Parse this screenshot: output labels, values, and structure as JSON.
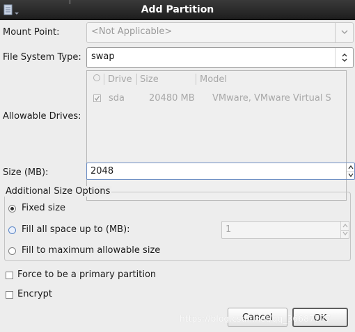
{
  "window": {
    "title": "Add Partition"
  },
  "mount_point": {
    "label": "Mount Point:",
    "value": "<Not Applicable>"
  },
  "fs_type": {
    "label": "File System Type:",
    "value": "swap"
  },
  "drives": {
    "label": "Allowable Drives:",
    "columns": [
      "Drive",
      "Size",
      "Model"
    ],
    "rows": [
      {
        "drive": "sda",
        "size": "20480 MB",
        "model": "VMware, VMware Virtual S"
      }
    ]
  },
  "size": {
    "label": "Size (MB):",
    "value": "2048"
  },
  "additional": {
    "title": "Additional Size Options",
    "fixed": "Fixed size",
    "fill_up_to": "Fill all space up to (MB):",
    "fill_up_to_value": "1",
    "fill_max": "Fill to maximum allowable size"
  },
  "primary_label": "Force to be a primary partition",
  "encrypt_label": "Encrypt",
  "buttons": {
    "cancel": "Cancel",
    "ok": "OK"
  },
  "watermark": "https://blog.csdn.net/qq_36687777",
  "colors": {
    "titlebar": "#2a2a2a",
    "dialog_bg": "#ededed",
    "focus_radio": "#5b86c6"
  }
}
